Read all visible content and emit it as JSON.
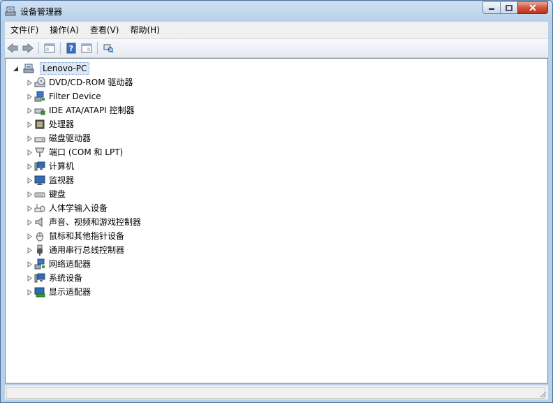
{
  "window": {
    "title": "设备管理器"
  },
  "menu": [
    "文件(F)",
    "操作(A)",
    "查看(V)",
    "帮助(H)"
  ],
  "toolbar": {
    "buttons": [
      "back-icon",
      "forward-icon",
      "console-tree-icon",
      "help-icon",
      "properties-icon",
      "scan-hardware-icon"
    ]
  },
  "tree": {
    "root": {
      "label": "Lenovo-PC",
      "icon": "computer-icon"
    },
    "children": [
      {
        "label": "DVD/CD-ROM 驱动器",
        "icon": "dvd-drive-icon"
      },
      {
        "label": "Filter Device",
        "icon": "filter-device-icon"
      },
      {
        "label": "IDE ATA/ATAPI 控制器",
        "icon": "ide-controller-icon"
      },
      {
        "label": "处理器",
        "icon": "processor-icon"
      },
      {
        "label": "磁盘驱动器",
        "icon": "disk-drive-icon"
      },
      {
        "label": "端口 (COM 和 LPT)",
        "icon": "port-icon"
      },
      {
        "label": "计算机",
        "icon": "computer-icon"
      },
      {
        "label": "监视器",
        "icon": "monitor-icon"
      },
      {
        "label": "键盘",
        "icon": "keyboard-icon"
      },
      {
        "label": "人体学输入设备",
        "icon": "hid-icon"
      },
      {
        "label": "声音、视频和游戏控制器",
        "icon": "speaker-icon"
      },
      {
        "label": "鼠标和其他指针设备",
        "icon": "mouse-icon"
      },
      {
        "label": "通用串行总线控制器",
        "icon": "usb-icon"
      },
      {
        "label": "网络适配器",
        "icon": "network-adapter-icon"
      },
      {
        "label": "系统设备",
        "icon": "system-device-icon"
      },
      {
        "label": "显示适配器",
        "icon": "display-adapter-icon"
      }
    ]
  },
  "status": {
    "text": ""
  }
}
